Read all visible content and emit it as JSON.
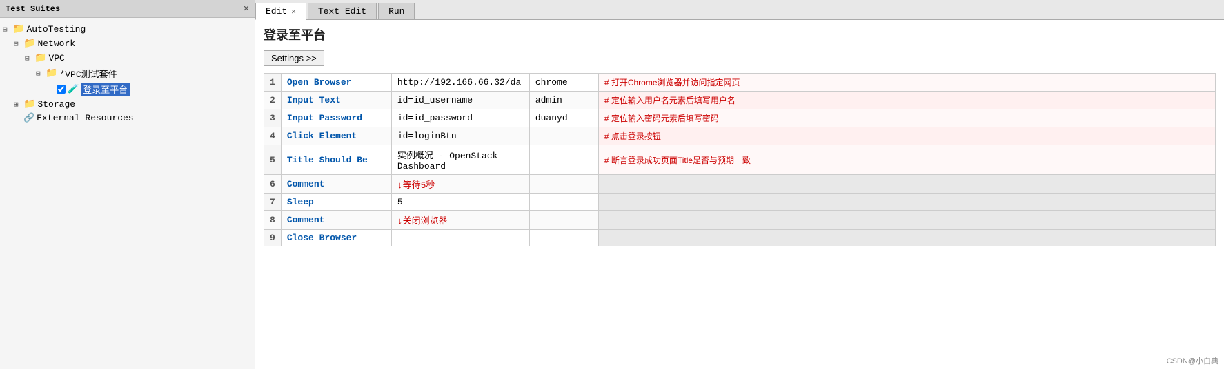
{
  "sidebar": {
    "title": "Test Suites",
    "close_label": "✕",
    "items": [
      {
        "id": "autotesting",
        "label": "AutoTesting",
        "type": "folder",
        "indent": 0,
        "expander": "⊟"
      },
      {
        "id": "network",
        "label": "Network",
        "type": "folder",
        "indent": 1,
        "expander": "⊟"
      },
      {
        "id": "vpc",
        "label": "VPC",
        "type": "folder",
        "indent": 2,
        "expander": "⊟"
      },
      {
        "id": "vpc-suite",
        "label": "*VPC测试套件",
        "type": "folder",
        "indent": 3,
        "expander": "⊟"
      },
      {
        "id": "login",
        "label": "登录至平台",
        "type": "test",
        "indent": 4,
        "expander": "",
        "checked": true,
        "selected": true
      },
      {
        "id": "storage",
        "label": "Storage",
        "type": "folder",
        "indent": 1,
        "expander": "⊞"
      },
      {
        "id": "external",
        "label": "External Resources",
        "type": "resource",
        "indent": 1,
        "expander": ""
      }
    ]
  },
  "tabs": [
    {
      "id": "edit",
      "label": "Edit",
      "active": true,
      "closeable": true
    },
    {
      "id": "text-edit",
      "label": "Text Edit",
      "active": false,
      "closeable": false
    },
    {
      "id": "run",
      "label": "Run",
      "active": false,
      "closeable": false
    }
  ],
  "test_title": "登录至平台",
  "settings_button": "Settings >>",
  "table": {
    "rows": [
      {
        "num": "1",
        "keyword": "Open Browser",
        "arg1": "http://192.166.66.32/da",
        "arg2": "chrome",
        "comment": "#  打开Chrome浏览器并访问指定网页"
      },
      {
        "num": "2",
        "keyword": "Input Text",
        "arg1": "id=id_username",
        "arg2": "admin",
        "comment": "#  定位输入用户名元素后填写用户名"
      },
      {
        "num": "3",
        "keyword": "Input Password",
        "arg1": "id=id_password",
        "arg2": "duanyd",
        "comment": "#  定位输入密码元素后填写密码"
      },
      {
        "num": "4",
        "keyword": "Click Element",
        "arg1": "id=loginBtn",
        "arg2": "",
        "comment": "#  点击登录按钮"
      },
      {
        "num": "5",
        "keyword": "Title Should Be",
        "arg1": "实例概况 - OpenStack Dashboard",
        "arg2": "",
        "comment": "#  断言登录成功页面Title是否与预期一致"
      },
      {
        "num": "6",
        "keyword": "Comment",
        "arg1": "↓等待5秒",
        "arg2": "",
        "comment": ""
      },
      {
        "num": "7",
        "keyword": "Sleep",
        "arg1": "5",
        "arg2": "",
        "comment": ""
      },
      {
        "num": "8",
        "keyword": "Comment",
        "arg1": "↓关闭浏览器",
        "arg2": "",
        "comment": ""
      },
      {
        "num": "9",
        "keyword": "Close Browser",
        "arg1": "",
        "arg2": "",
        "comment": ""
      }
    ]
  },
  "watermark": "CSDN@小白典"
}
